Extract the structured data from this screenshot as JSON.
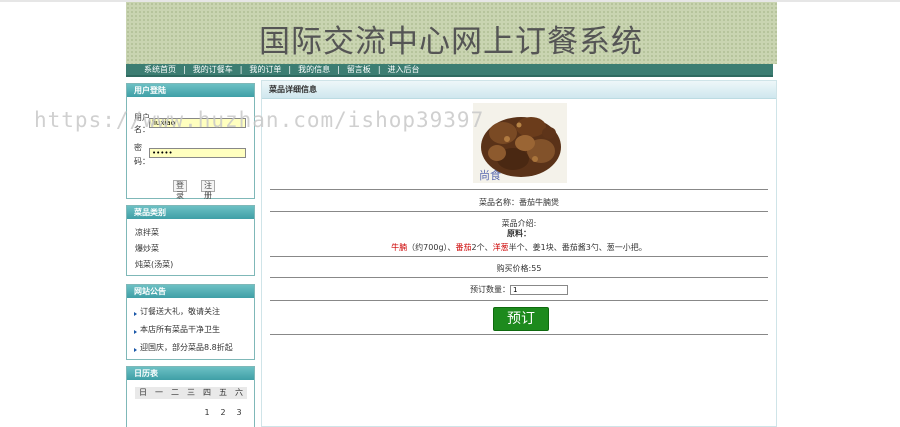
{
  "header": {
    "title": "国际交流中心网上订餐系统"
  },
  "nav": {
    "items": [
      "系统首页",
      "我的订餐车",
      "我的订单",
      "我的信息",
      "留言板",
      "进入后台"
    ]
  },
  "login": {
    "heading": "用户登陆",
    "username_label_1": "用户",
    "username_label_2": "名：",
    "username_value": "liuxiao",
    "password_label_1": "密",
    "password_label_2": "码：",
    "password_value": "•••••",
    "login_button": "登 录",
    "register_button": "注 册"
  },
  "categories": {
    "heading": "菜品类别",
    "items": [
      "凉拌菜",
      "爆炒菜",
      "炖菜(汤菜)"
    ]
  },
  "announcements": {
    "heading": "网站公告",
    "items": [
      "订餐送大礼，敬请关注",
      "本店所有菜品干净卫生",
      "迎国庆，部分菜品8.8折起"
    ]
  },
  "calendar": {
    "heading": "日历表",
    "weekdays": [
      "日",
      "一",
      "二",
      "三",
      "四",
      "五",
      "六"
    ],
    "first_row": [
      "",
      "",
      "",
      "",
      "1",
      "2",
      "3"
    ]
  },
  "detail": {
    "heading": "菜品详细信息",
    "name_line": "菜品名称：番茄牛腩煲",
    "intro_label": "菜品介绍:",
    "ingredients_label": "原料：",
    "ing_beef": "牛腩",
    "ing_beef_qty": "（约700g）、",
    "ing_tomato": "番茄",
    "ing_tomato_qty": "2个、",
    "ing_onion": "洋葱",
    "ing_onion_rest": "半个、姜1块、番茄酱3勺、葱一小把。",
    "price_line": "购买价格:55",
    "quantity_label": "预订数量：",
    "quantity_value": "1",
    "order_button": "预订",
    "image_caption": "尚食"
  },
  "watermark": {
    "text": "https://www.huzhan.com/ishop39397"
  },
  "colors": {
    "nav": "#3c7d72",
    "side_head": "#3f9fa6",
    "order_button": "#1d8a1d",
    "accent_red": "#cc0000"
  }
}
